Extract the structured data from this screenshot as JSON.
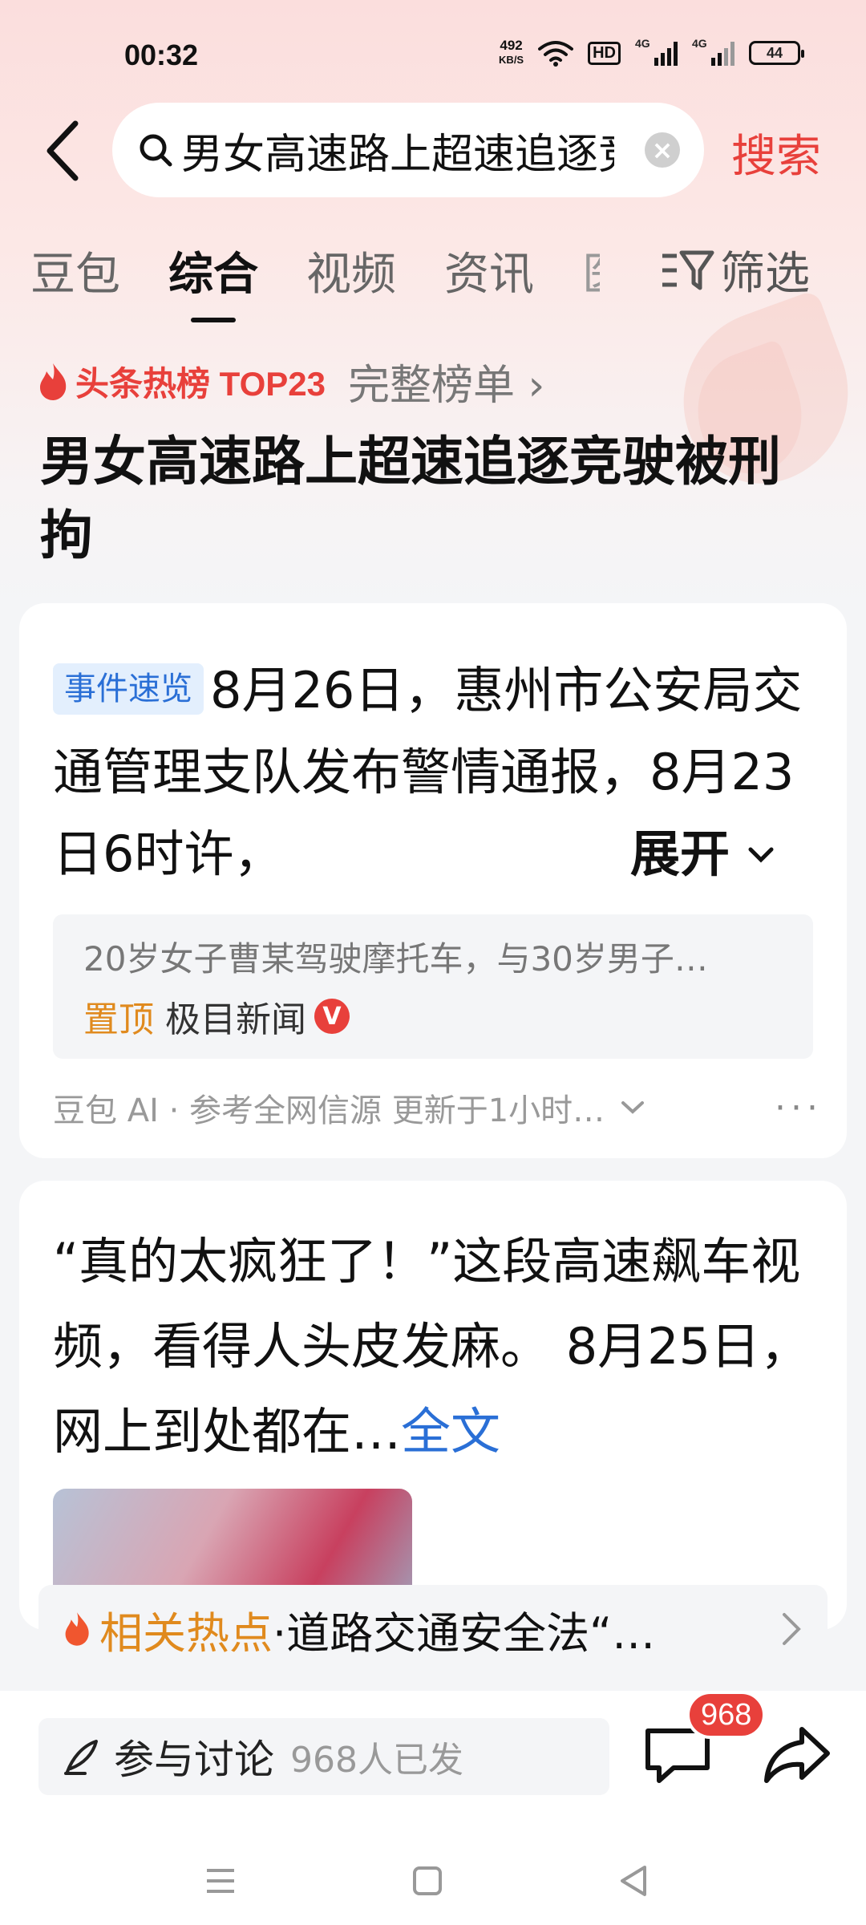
{
  "status_bar": {
    "time": "00:32",
    "net_speed_value": "492",
    "net_speed_unit": "KB/S",
    "hd_label": "HD",
    "signal_tag_1": "4G",
    "signal_tag_2": "4G",
    "battery": "44"
  },
  "search": {
    "query": "男女高速路上超速追逐竞驶被刑拘",
    "search_button": "搜索",
    "clear_symbol": "×"
  },
  "tabs": [
    {
      "label": "豆包",
      "active": false
    },
    {
      "label": "综合",
      "active": true
    },
    {
      "label": "视频",
      "active": false
    },
    {
      "label": "资讯",
      "active": false
    },
    {
      "label": "医",
      "active": false
    }
  ],
  "filter_label": "筛选",
  "hot": {
    "label": "头条热榜 TOP23",
    "more": "完整榜单 ›"
  },
  "headline": "男女高速路上超速追逐竞驶被刑拘",
  "summary_card": {
    "badge": "事件速览",
    "text": "8月26日，惠州市公安局交通管理支队发布警情通报，8月23日6时许，",
    "expand": "展开",
    "source_snippet": "20岁女子曹某驾驶摩托车，与30岁男子…",
    "pin_label": "置顶",
    "source_name": "极目新闻",
    "verified_mark": "V",
    "footer": "豆包 AI · 参考全网信源 更新于1小时…",
    "more_dots": "···"
  },
  "article_card": {
    "text": "“真的太疯狂了！”这段高速飙车视频，看得人头皮发麻。 8月25日，网上到处都在…",
    "full_text_link": "全文"
  },
  "related": {
    "label": "相关热点",
    "text": "·道路交通安全法“…"
  },
  "bottom": {
    "discuss_label": "参与讨论",
    "discuss_count": "968人已发",
    "comment_badge": "968"
  },
  "colors": {
    "accent_red": "#e8403b",
    "link_blue": "#2a6fd6",
    "orange": "#e08a1e"
  }
}
